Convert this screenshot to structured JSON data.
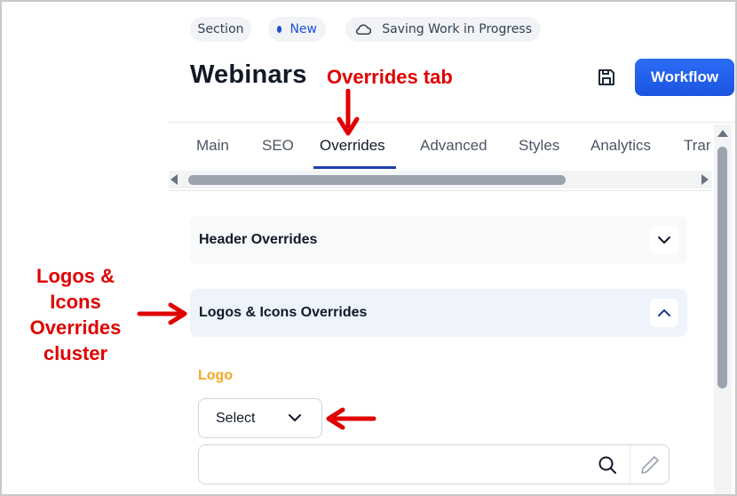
{
  "pills": {
    "section": "Section",
    "status": "New",
    "saving": "Saving Work in Progress"
  },
  "page": {
    "title": "Webinars",
    "workflow_button": "Workflow"
  },
  "tabs": [
    {
      "label": "Main"
    },
    {
      "label": "SEO"
    },
    {
      "label": "Overrides",
      "active": true
    },
    {
      "label": "Advanced"
    },
    {
      "label": "Styles"
    },
    {
      "label": "Analytics"
    },
    {
      "label": "Tran"
    }
  ],
  "accordions": {
    "header": "Header Overrides",
    "logos": "Logos & Icons Overrides"
  },
  "logo_field": {
    "label": "Logo",
    "select_value": "Select",
    "search_value": ""
  },
  "annotations": {
    "overrides_tab": "Overrides tab",
    "cluster_line1": "Logos &",
    "cluster_line2": "Icons",
    "cluster_line3": "Overrides",
    "cluster_line4": "cluster"
  },
  "colors": {
    "accent": "#1d4ed8",
    "workflow": "#2b6cf6",
    "logo_label": "#f5a623",
    "annotation": "#e00000"
  },
  "icons": {
    "saving": "cloud-icon",
    "save": "save-icon",
    "accordion_collapsed": "chevron-down-icon",
    "accordion_expanded": "chevron-up-icon",
    "select": "chevron-down-icon",
    "search": "search-icon",
    "edit": "pencil-icon"
  }
}
